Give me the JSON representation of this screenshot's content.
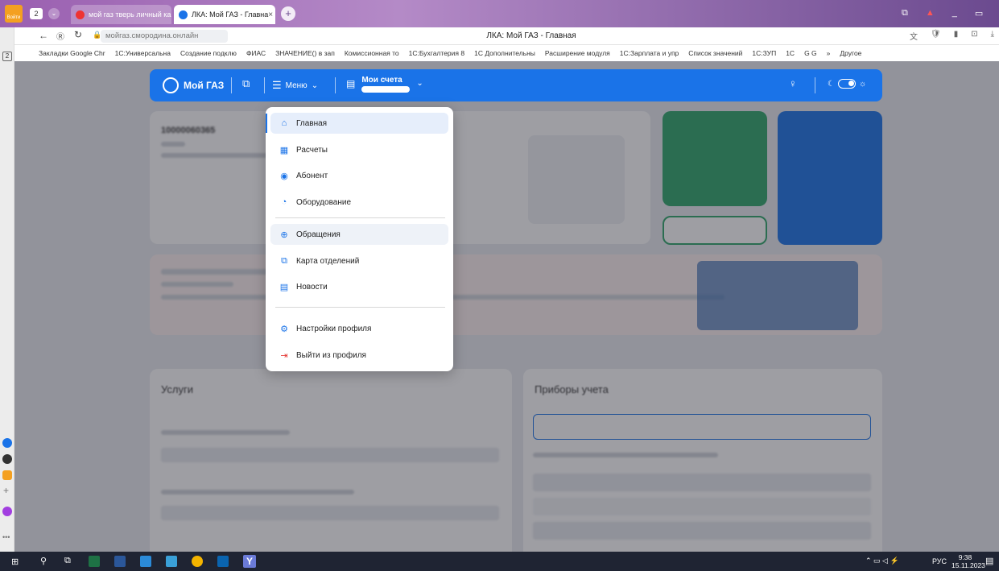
{
  "browser": {
    "tab_count": "2",
    "tabs": [
      {
        "title": "мой газ тверь личный ка",
        "active": false
      },
      {
        "title": "ЛКА: Мой ГАЗ - Главна",
        "active": true
      }
    ],
    "address": "мойгаз.смородина.онлайн",
    "page_title": "ЛКА: Мой ГАЗ - Главная",
    "sidebar_badge": "2",
    "bookmarks": [
      "Закладки Google Chr",
      "1С:Универсальна",
      "Создание подклю",
      "ФИАС",
      "ЗНАЧЕНИЕ() в зап",
      "Комиссионная то",
      "1С:Бухгалтерия 8",
      "1С Дополнительны",
      "Расширение модуля",
      "1С:Зарплата и упр",
      "Список значений",
      "1С:ЗУП",
      "1С",
      "G G",
      "»",
      "Другое"
    ]
  },
  "header": {
    "brand": "Мой ГАЗ",
    "menu_label": "Меню",
    "accounts_label": "Мои счета",
    "accent": "#1a73e8"
  },
  "menu": {
    "items": [
      {
        "label": "Главная",
        "icon": "home-icon"
      },
      {
        "label": "Расчеты",
        "icon": "calculator-icon"
      },
      {
        "label": "Абонент",
        "icon": "user-icon"
      },
      {
        "label": "Оборудование",
        "icon": "gauge-icon"
      },
      {
        "label": "Обращения",
        "icon": "chat-icon"
      },
      {
        "label": "Карта отделений",
        "icon": "map-icon"
      },
      {
        "label": "Новости",
        "icon": "news-icon"
      },
      {
        "label": "Настройки профиля",
        "icon": "settings-icon"
      },
      {
        "label": "Выйти из профиля",
        "icon": "logout-icon",
        "color": "#e53935"
      }
    ]
  },
  "page": {
    "account_number": "10000060365",
    "services_title": "Услуги",
    "meters_title": "Приборы учета"
  },
  "taskbar": {
    "lang": "РУС",
    "time": "9:38",
    "date": "15.11.2023"
  },
  "yandex_label": "Войти"
}
